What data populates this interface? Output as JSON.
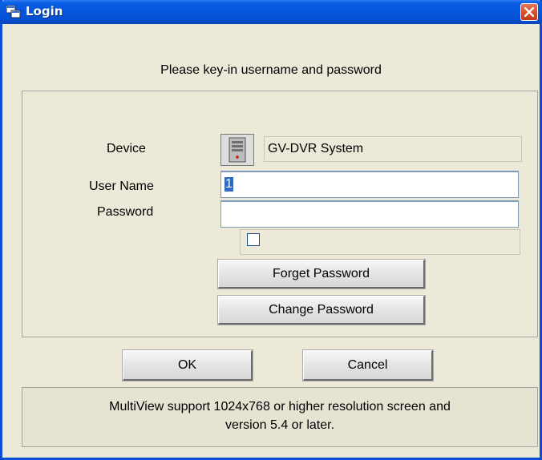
{
  "window": {
    "title": "Login",
    "close_label": "Close"
  },
  "instruction": "Please key-in username and password",
  "form": {
    "device_label": "Device",
    "device_value": "GV-DVR System",
    "username_label": "User Name",
    "username_value": "1",
    "password_label": "Password",
    "password_value": "",
    "remember_checked": false
  },
  "buttons": {
    "forget_password": "Forget Password",
    "change_password": "Change Password",
    "ok": "OK",
    "cancel": "Cancel"
  },
  "footer": {
    "line1": "MultiView support 1024x768 or higher resolution screen and",
    "line2": "version 5.4 or later."
  },
  "icons": {
    "title": "window-icon",
    "close": "close-icon",
    "device": "dvr-device-icon"
  },
  "colors": {
    "titlebar": "#0450d3",
    "close_button": "#d94f2a",
    "dialog_background": "#ece9d8",
    "selection": "#316ac5"
  }
}
